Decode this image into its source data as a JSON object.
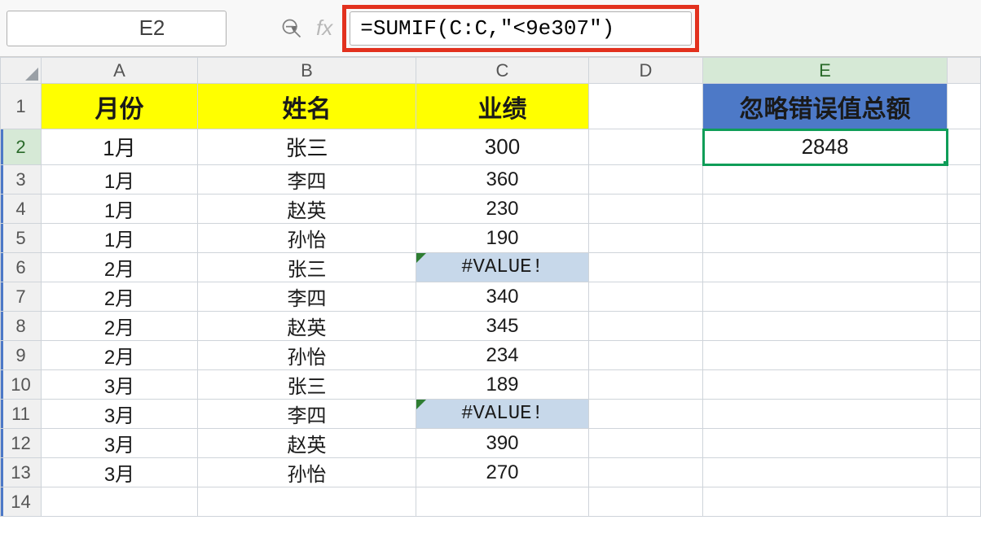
{
  "name_box": {
    "value": "E2"
  },
  "formula_bar": {
    "value": "=SUMIF(C:C,\"<9e307\")"
  },
  "columns": [
    "A",
    "B",
    "C",
    "D",
    "E"
  ],
  "row_numbers": [
    "1",
    "2",
    "3",
    "4",
    "5",
    "6",
    "7",
    "8",
    "9",
    "10",
    "11",
    "12",
    "13",
    "14"
  ],
  "active_cell": "E2",
  "header_row": {
    "A": "月份",
    "B": "姓名",
    "C": "业绩",
    "E": "忽略错误值总额"
  },
  "result": {
    "E2": "2848"
  },
  "rows": [
    {
      "A": "1月",
      "B": "张三",
      "C": "300"
    },
    {
      "A": "1月",
      "B": "李四",
      "C": "360"
    },
    {
      "A": "1月",
      "B": "赵英",
      "C": "230"
    },
    {
      "A": "1月",
      "B": "孙怡",
      "C": "190"
    },
    {
      "A": "2月",
      "B": "张三",
      "C": "#VALUE!",
      "err": true
    },
    {
      "A": "2月",
      "B": "李四",
      "C": "340"
    },
    {
      "A": "2月",
      "B": "赵英",
      "C": "345"
    },
    {
      "A": "2月",
      "B": "孙怡",
      "C": "234"
    },
    {
      "A": "3月",
      "B": "张三",
      "C": "189"
    },
    {
      "A": "3月",
      "B": "李四",
      "C": "#VALUE!",
      "err": true
    },
    {
      "A": "3月",
      "B": "赵英",
      "C": "390"
    },
    {
      "A": "3月",
      "B": "孙怡",
      "C": "270"
    }
  ],
  "chart_data": {
    "type": "table",
    "title": "忽略错误值总额",
    "columns": [
      "月份",
      "姓名",
      "业绩"
    ],
    "data": [
      [
        "1月",
        "张三",
        300
      ],
      [
        "1月",
        "李四",
        360
      ],
      [
        "1月",
        "赵英",
        230
      ],
      [
        "1月",
        "孙怡",
        190
      ],
      [
        "2月",
        "张三",
        "#VALUE!"
      ],
      [
        "2月",
        "李四",
        340
      ],
      [
        "2月",
        "赵英",
        345
      ],
      [
        "2月",
        "孙怡",
        234
      ],
      [
        "3月",
        "张三",
        189
      ],
      [
        "3月",
        "李四",
        "#VALUE!"
      ],
      [
        "3月",
        "赵英",
        390
      ],
      [
        "3月",
        "孙怡",
        270
      ]
    ],
    "formula": "=SUMIF(C:C,\"<9e307\")",
    "result": 2848
  }
}
